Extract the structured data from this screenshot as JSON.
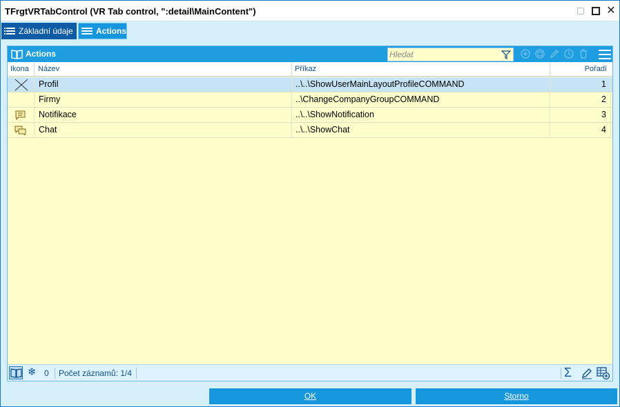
{
  "window": {
    "title": "TFrgtVRTabControl (VR Tab control, \":detail\\MainContent\")"
  },
  "tabs": [
    {
      "label": "Základní údaje",
      "active": false
    },
    {
      "label": "Actions",
      "active": true
    }
  ],
  "panel": {
    "title": "Actions",
    "search_placeholder": "Hledat"
  },
  "table": {
    "columns": [
      "Ikona",
      "Název",
      "Příkaz",
      "Pořadí"
    ],
    "rows": [
      {
        "icon": "x-icon",
        "name": "Profil",
        "command": "..\\..\\ShowUserMainLayoutProfileCOMMAND",
        "order": "1",
        "selected": true
      },
      {
        "icon": "",
        "name": "Firmy",
        "command": "..\\ChangeCompanyGroupCOMMAND",
        "order": "2",
        "selected": false
      },
      {
        "icon": "comment-icon",
        "name": "Notifikace",
        "command": "..\\..\\ShowNotification",
        "order": "3",
        "selected": false
      },
      {
        "icon": "chat-icon",
        "name": "Chat",
        "command": "..\\..\\ShowChat",
        "order": "4",
        "selected": false
      }
    ]
  },
  "statusbar": {
    "filter_count": "0",
    "record_count": "Počet záznamů: 1/4"
  },
  "buttons": {
    "ok": "OK",
    "cancel": "Storno"
  },
  "colors": {
    "accent": "#1696dd",
    "dark_tab": "#0e5ba6",
    "grid_background": "#ffffcc",
    "selected_row": "#c7e4f7"
  }
}
